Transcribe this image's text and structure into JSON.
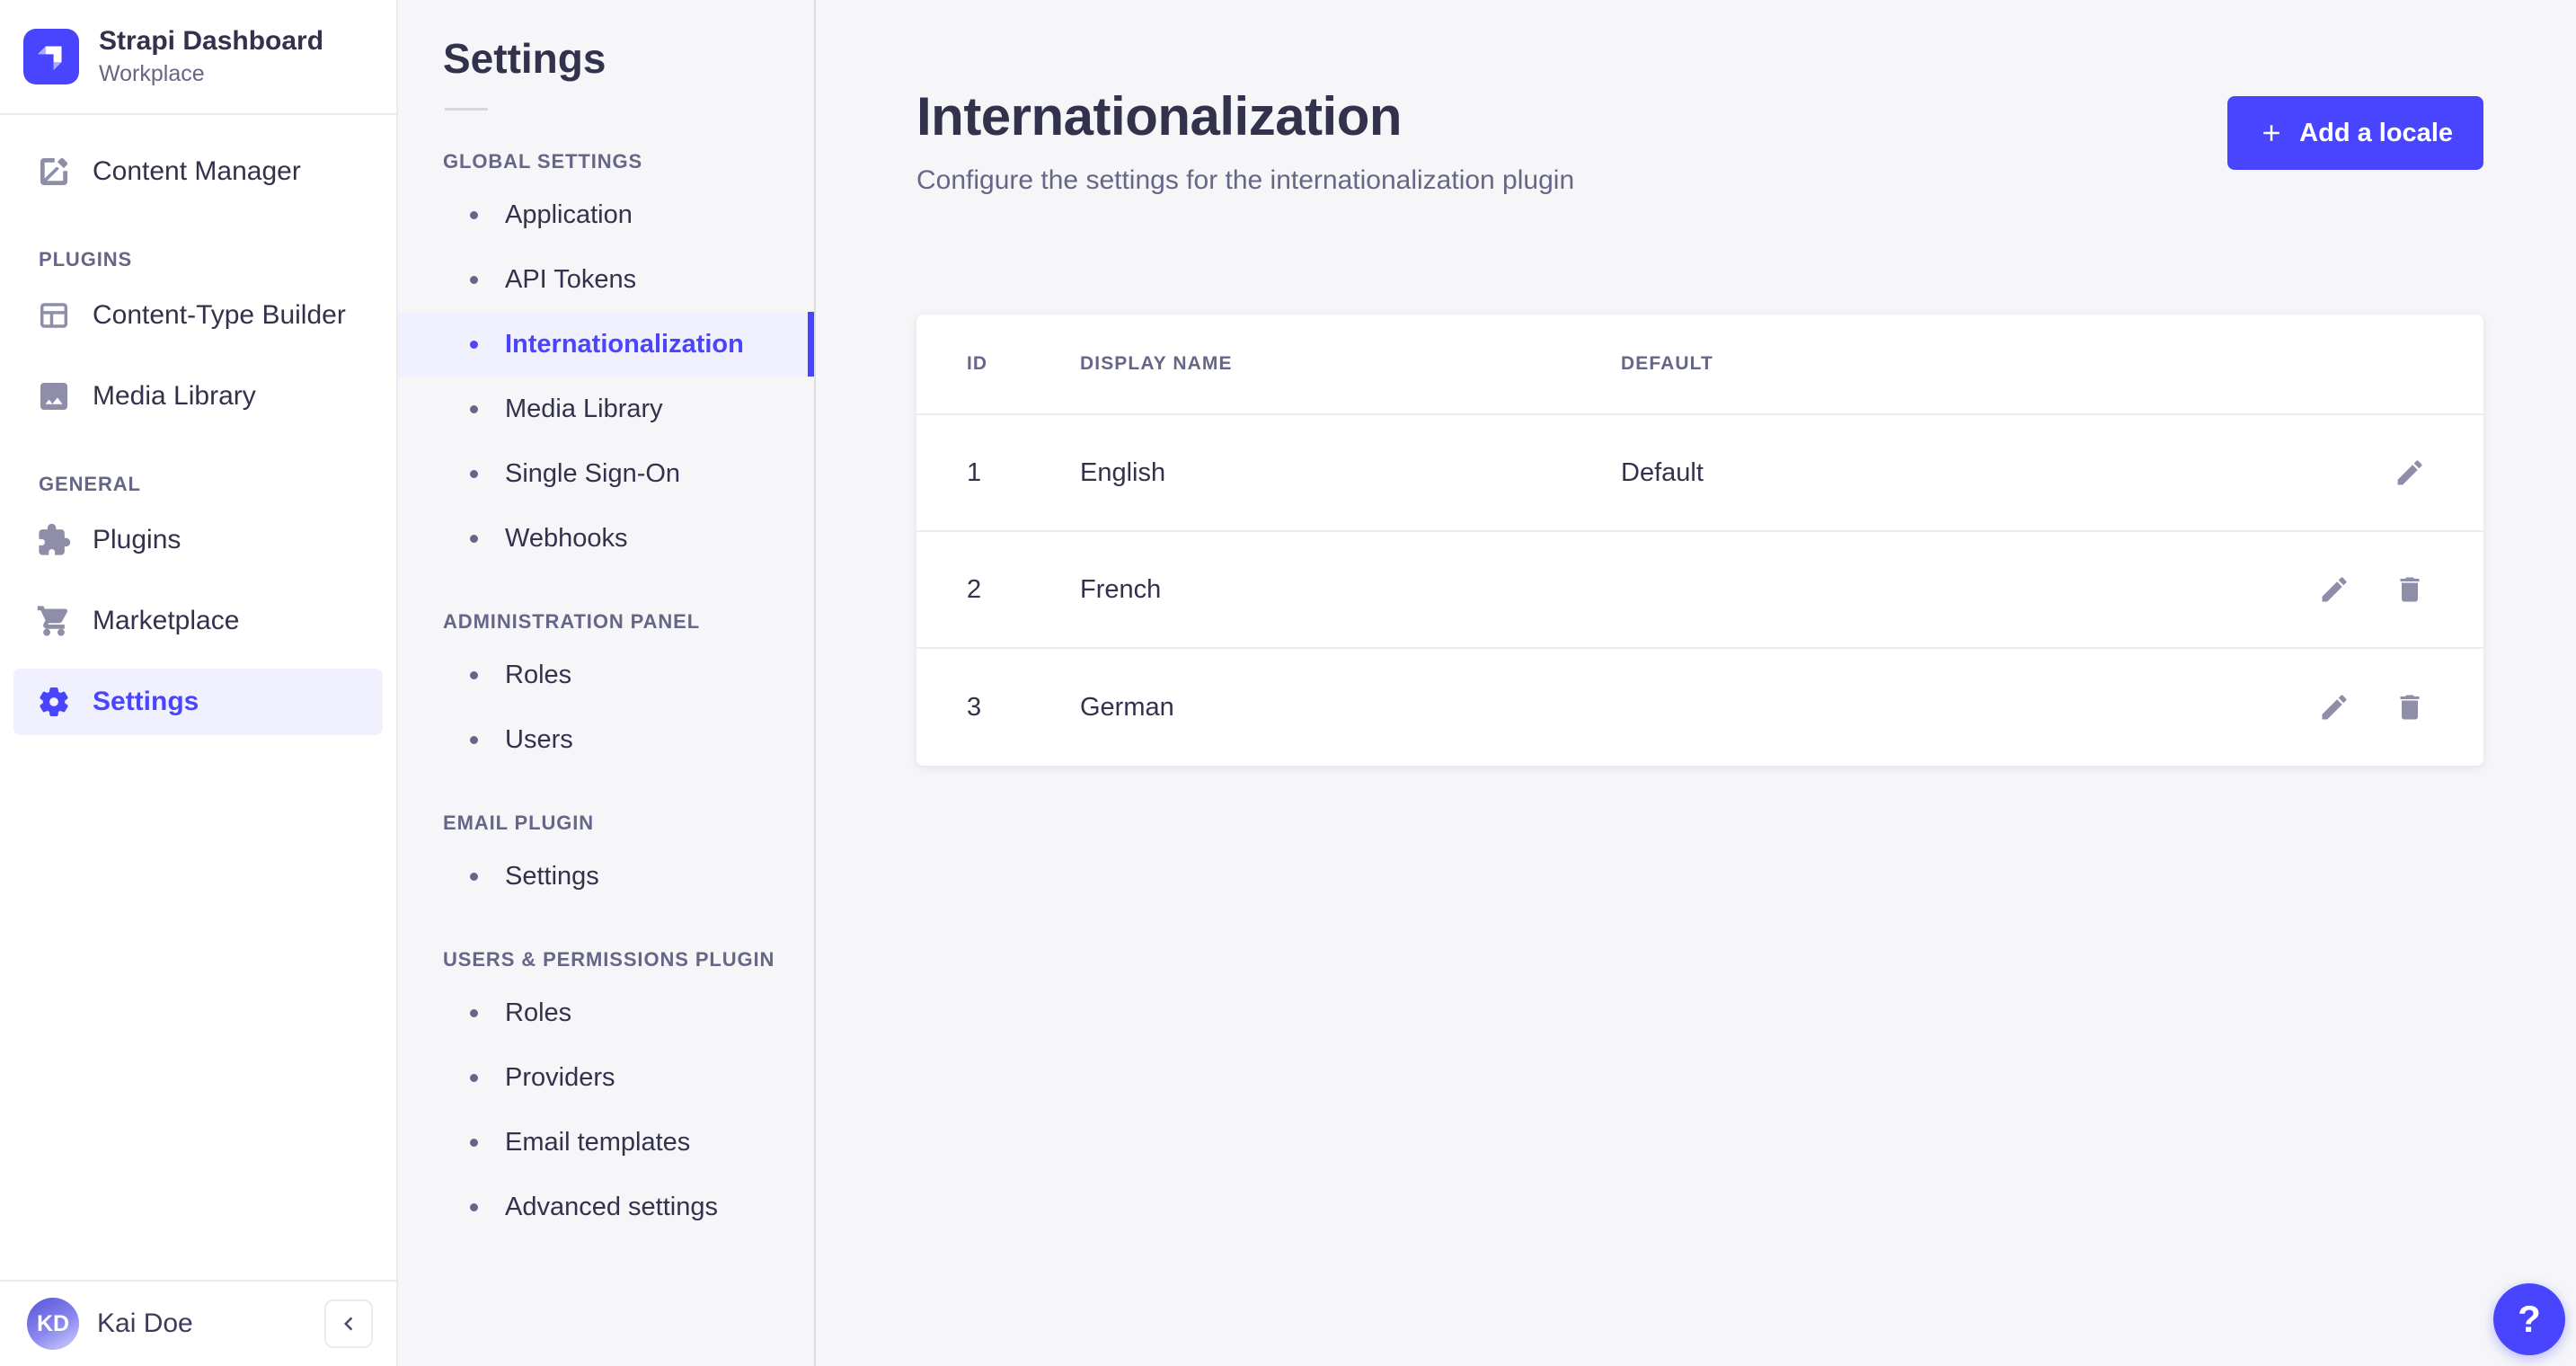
{
  "colors": {
    "primary": "#4945ff",
    "primary_light": "#f0f0ff",
    "text_dark": "#32324d",
    "text_muted": "#666687",
    "icon_gray": "#8e8ea9",
    "background": "#f6f6f9",
    "border": "#eaeaef"
  },
  "brand": {
    "name": "Strapi Dashboard",
    "workspace": "Workplace",
    "logo_icon": "strapi-mark-icon"
  },
  "sidebar": {
    "sections": [
      {
        "label": "",
        "items": [
          {
            "label": "Content Manager",
            "icon": "write-icon",
            "active": false
          }
        ]
      },
      {
        "label": "PLUGINS",
        "items": [
          {
            "label": "Content-Type Builder",
            "icon": "layout-icon",
            "active": false
          },
          {
            "label": "Media Library",
            "icon": "image-icon",
            "active": false
          }
        ]
      },
      {
        "label": "GENERAL",
        "items": [
          {
            "label": "Plugins",
            "icon": "puzzle-icon",
            "active": false
          },
          {
            "label": "Marketplace",
            "icon": "cart-icon",
            "active": false
          },
          {
            "label": "Settings",
            "icon": "gear-icon",
            "active": true
          }
        ]
      }
    ],
    "footer": {
      "initials": "KD",
      "name": "Kai Doe",
      "collapse_icon": "chevron-left-icon"
    }
  },
  "subnav": {
    "title": "Settings",
    "sections": [
      {
        "label": "GLOBAL SETTINGS",
        "items": [
          {
            "label": "Application",
            "active": false
          },
          {
            "label": "API Tokens",
            "active": false
          },
          {
            "label": "Internationalization",
            "active": true
          },
          {
            "label": "Media Library",
            "active": false
          },
          {
            "label": "Single Sign-On",
            "active": false
          },
          {
            "label": "Webhooks",
            "active": false
          }
        ]
      },
      {
        "label": "ADMINISTRATION PANEL",
        "items": [
          {
            "label": "Roles",
            "active": false
          },
          {
            "label": "Users",
            "active": false
          }
        ]
      },
      {
        "label": "EMAIL PLUGIN",
        "items": [
          {
            "label": "Settings",
            "active": false
          }
        ]
      },
      {
        "label": "USERS & PERMISSIONS PLUGIN",
        "items": [
          {
            "label": "Roles",
            "active": false
          },
          {
            "label": "Providers",
            "active": false
          },
          {
            "label": "Email templates",
            "active": false
          },
          {
            "label": "Advanced settings",
            "active": false
          }
        ]
      }
    ]
  },
  "main": {
    "title": "Internationalization",
    "subtitle": "Configure the settings for the internationalization plugin",
    "add_locale_button": "Add a locale",
    "table": {
      "headers": [
        "ID",
        "DISPLAY NAME",
        "DEFAULT"
      ],
      "rows": [
        {
          "id": "1",
          "display_name": "English",
          "default": "Default",
          "actions": [
            "edit"
          ]
        },
        {
          "id": "2",
          "display_name": "French",
          "default": "",
          "actions": [
            "edit",
            "delete"
          ]
        },
        {
          "id": "3",
          "display_name": "German",
          "default": "",
          "actions": [
            "edit",
            "delete"
          ]
        }
      ]
    },
    "help_button": "?"
  }
}
